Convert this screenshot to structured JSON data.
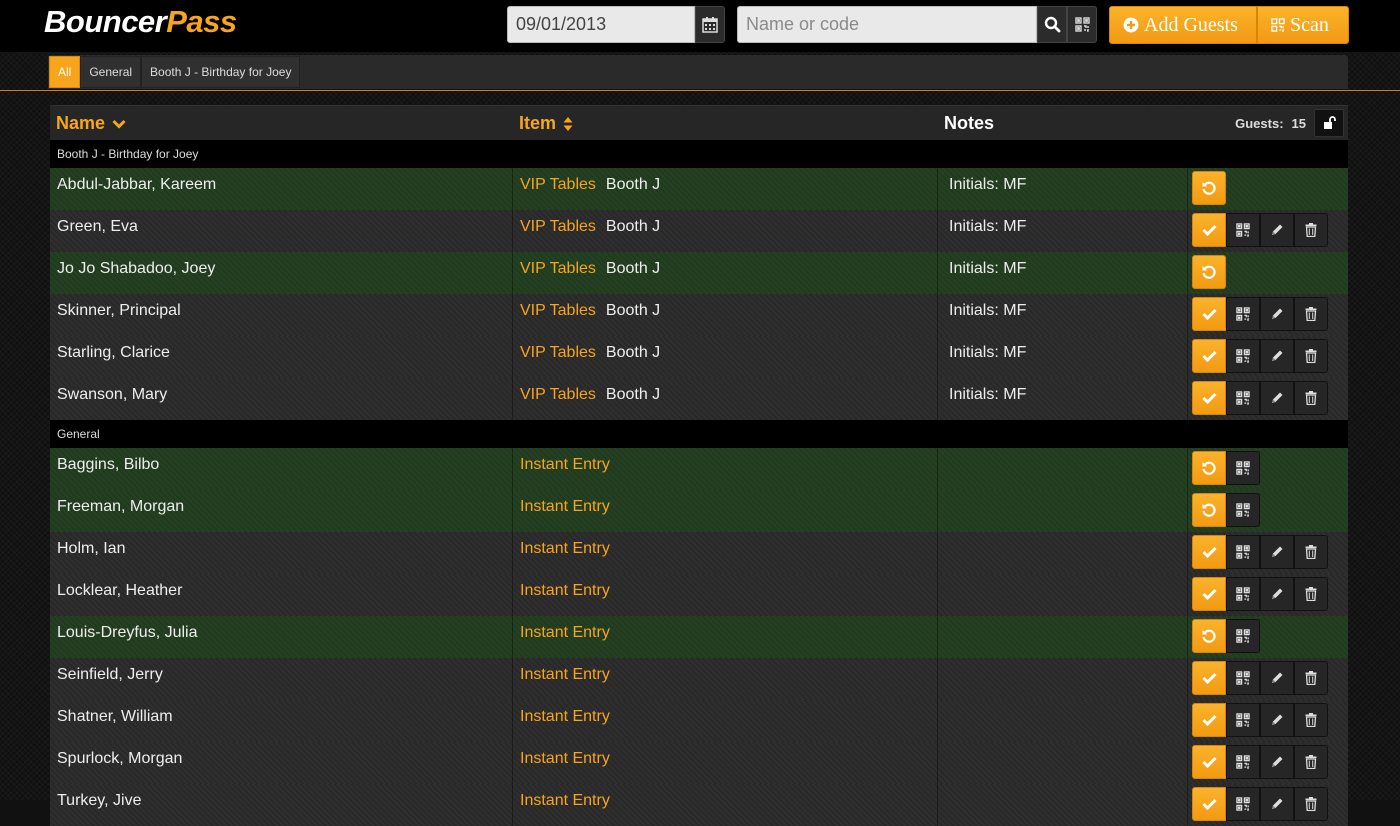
{
  "app": {
    "logo_part1": "Bouncer",
    "logo_part2": "Pass"
  },
  "toolbar": {
    "date_value": "09/01/2013",
    "search_placeholder": "Name or code",
    "add_guests_label": "Add Guests",
    "scan_label": "Scan"
  },
  "filters": [
    {
      "label": "All",
      "active": true
    },
    {
      "label": "General",
      "active": false
    },
    {
      "label": "Booth J - Birthday for Joey",
      "active": false
    }
  ],
  "table": {
    "columns": {
      "name": "Name",
      "item": "Item",
      "notes": "Notes"
    },
    "guests_label": "Guests:",
    "guests_count": "15",
    "groups": [
      {
        "title": "Booth J - Birthday for Joey",
        "rows": [
          {
            "name": "Abdul-Jabbar, Kareem",
            "item": "VIP Tables",
            "detail": "Booth J",
            "notes": "Initials: MF",
            "checked_in": true
          },
          {
            "name": "Green, Eva",
            "item": "VIP Tables",
            "detail": "Booth J",
            "notes": "Initials: MF",
            "checked_in": false
          },
          {
            "name": "Jo Jo Shabadoo, Joey",
            "item": "VIP Tables",
            "detail": "Booth J",
            "notes": "Initials: MF",
            "checked_in": true
          },
          {
            "name": "Skinner, Principal",
            "item": "VIP Tables",
            "detail": "Booth J",
            "notes": "Initials: MF",
            "checked_in": false
          },
          {
            "name": "Starling, Clarice",
            "item": "VIP Tables",
            "detail": "Booth J",
            "notes": "Initials: MF",
            "checked_in": false
          },
          {
            "name": "Swanson, Mary",
            "item": "VIP Tables",
            "detail": "Booth J",
            "notes": "Initials: MF",
            "checked_in": false
          }
        ]
      },
      {
        "title": "General",
        "rows": [
          {
            "name": "Baggins, Bilbo",
            "item": "Instant Entry",
            "detail": "",
            "notes": "",
            "checked_in": true
          },
          {
            "name": "Freeman, Morgan",
            "item": "Instant Entry",
            "detail": "",
            "notes": "",
            "checked_in": true
          },
          {
            "name": "Holm, Ian",
            "item": "Instant Entry",
            "detail": "",
            "notes": "",
            "checked_in": false
          },
          {
            "name": "Locklear, Heather",
            "item": "Instant Entry",
            "detail": "",
            "notes": "",
            "checked_in": false
          },
          {
            "name": "Louis-Dreyfus, Julia",
            "item": "Instant Entry",
            "detail": "",
            "notes": "",
            "checked_in": true
          },
          {
            "name": "Seinfield, Jerry",
            "item": "Instant Entry",
            "detail": "",
            "notes": "",
            "checked_in": false
          },
          {
            "name": "Shatner, William",
            "item": "Instant Entry",
            "detail": "",
            "notes": "",
            "checked_in": false
          },
          {
            "name": "Spurlock, Morgan",
            "item": "Instant Entry",
            "detail": "",
            "notes": "",
            "checked_in": false
          },
          {
            "name": "Turkey, Jive",
            "item": "Instant Entry",
            "detail": "",
            "notes": "",
            "checked_in": false
          }
        ]
      }
    ]
  },
  "icons": {
    "calendar": "calendar-icon",
    "search": "search-icon",
    "qr": "qr-code-icon",
    "add": "plus-circle-icon",
    "check": "check-icon",
    "undo": "undo-icon",
    "edit": "pencil-icon",
    "delete": "trash-icon",
    "lock": "unlock-icon"
  },
  "colors": {
    "accent": "#f7a51c",
    "checked_row": "#1f3a1c",
    "default_row": "#282828"
  }
}
